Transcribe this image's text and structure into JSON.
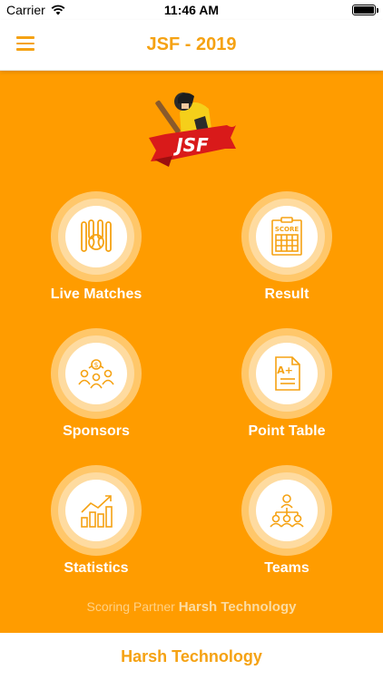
{
  "status_bar": {
    "carrier": "Carrier",
    "time": "11:46 AM"
  },
  "header": {
    "title": "JSF - 2019",
    "menu_icon": "hamburger-menu-icon"
  },
  "logo": {
    "text": "JSF"
  },
  "menu_tiles": [
    {
      "label": "Live Matches",
      "icon": "cricket-wickets-ball-icon"
    },
    {
      "label": "Result",
      "icon": "scoreboard-icon",
      "icon_text": "SCORE"
    },
    {
      "label": "Sponsors",
      "icon": "sponsors-people-dollar-icon"
    },
    {
      "label": "Point Table",
      "icon": "grade-document-icon",
      "icon_text": "A+"
    },
    {
      "label": "Statistics",
      "icon": "bar-chart-trend-icon"
    },
    {
      "label": "Teams",
      "icon": "team-hierarchy-icon"
    }
  ],
  "scoring_partner": {
    "prefix": "Scoring Partner",
    "name": "Harsh Technology"
  },
  "footer": {
    "name": "Harsh Technology"
  },
  "colors": {
    "primary_orange": "#ff9c00",
    "accent": "#f5a213",
    "white": "#ffffff"
  }
}
